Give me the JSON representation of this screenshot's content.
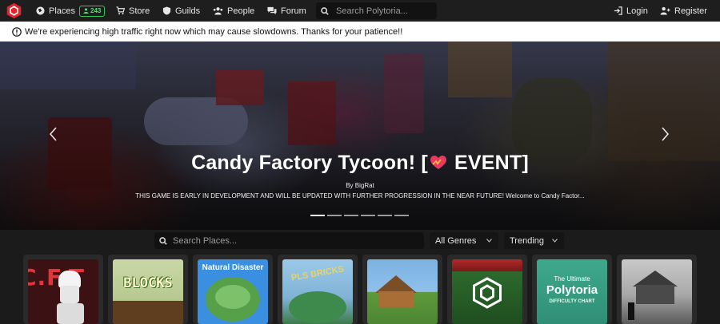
{
  "nav": {
    "logo_icon": "polytoria-logo-icon",
    "places_label": "Places",
    "places_count": "243",
    "store_label": "Store",
    "guilds_label": "Guilds",
    "people_label": "People",
    "forum_label": "Forum",
    "search_placeholder": "Search Polytoria...",
    "login_label": "Login",
    "register_label": "Register"
  },
  "notice": {
    "icon": "alert-circle-icon",
    "text": "We're experiencing high traffic right now which may cause slowdowns. Thanks for your patience!!"
  },
  "hero": {
    "title_before": "Candy Factory Tycoon! [",
    "title_icon": "heart-icon",
    "title_after": " EVENT]",
    "author": "By BigRat",
    "description": "THIS GAME IS EARLY IN DEVELOPMENT AND WILL BE UPDATED WITH FURTHER PROGRESSION IN THE NEAR FUTURE! Welcome to Candy Factor...",
    "slide_count": 6,
    "active_slide": 1
  },
  "filters": {
    "search_placeholder": "Search Places...",
    "genre": "All Genres",
    "sort": "Trending"
  },
  "places": [
    {
      "thumb_text": "C.F.T"
    },
    {
      "thumb_text": "BLOCKS"
    },
    {
      "thumb_text": "Natural Disaster"
    },
    {
      "thumb_text": "PLS BRICKS"
    },
    {
      "thumb_text": ""
    },
    {
      "thumb_text": ""
    },
    {
      "thumb_text": "Polytoria",
      "thumb_subtext": "The Ultimate",
      "thumb_subtext2": "DIFFICULTY CHART"
    },
    {
      "thumb_text": ""
    }
  ],
  "colors": {
    "brand": "#e5232a",
    "badge_green": "#34c759",
    "nav_bg": "#1e1e1e",
    "page_bg": "#1b1b1b"
  }
}
